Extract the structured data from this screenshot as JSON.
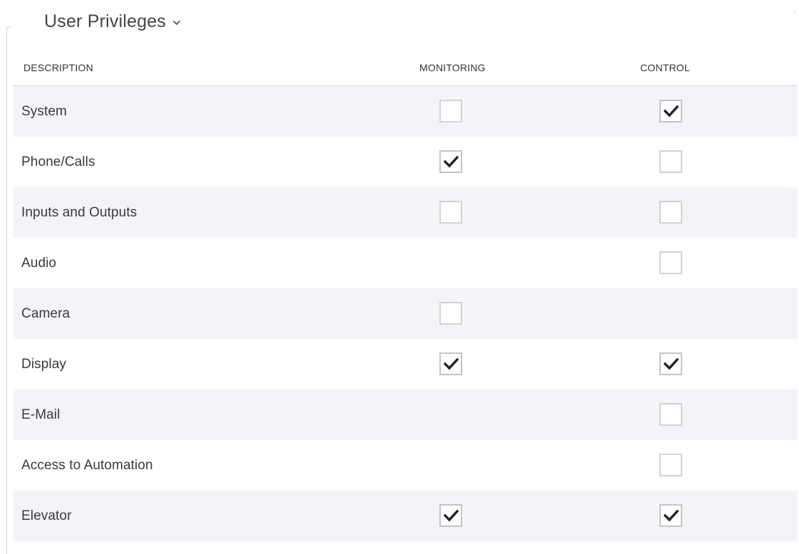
{
  "section": {
    "title": "User Privileges",
    "chevron_icon": "chevron-down-icon"
  },
  "table": {
    "headers": {
      "description": "DESCRIPTION",
      "monitoring": "MONITORING",
      "control": "CONTROL"
    },
    "rows": [
      {
        "label": "System",
        "monitoring": false,
        "control": true
      },
      {
        "label": "Phone/Calls",
        "monitoring": true,
        "control": false
      },
      {
        "label": "Inputs and Outputs",
        "monitoring": false,
        "control": false
      },
      {
        "label": "Audio",
        "monitoring": null,
        "control": false
      },
      {
        "label": "Camera",
        "monitoring": false,
        "control": null
      },
      {
        "label": "Display",
        "monitoring": true,
        "control": true
      },
      {
        "label": "E-Mail",
        "monitoring": null,
        "control": false
      },
      {
        "label": "Access to Automation",
        "monitoring": null,
        "control": false
      },
      {
        "label": "Elevator",
        "monitoring": true,
        "control": true
      }
    ]
  },
  "colors": {
    "row_shade": "#f2f4f8",
    "checkbox_border": "#d2d2d2",
    "checkmark": "#222222",
    "header_divider": "#cfd4da"
  }
}
